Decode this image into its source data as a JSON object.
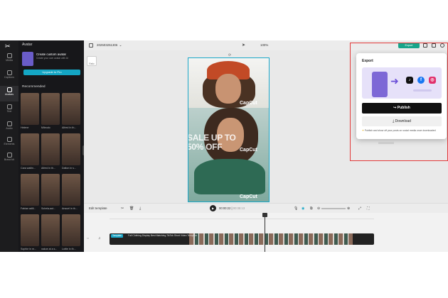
{
  "rail": {
    "items": [
      {
        "label": "Media"
      },
      {
        "label": "Captions"
      },
      {
        "label": "Avatars"
      },
      {
        "label": "Text"
      },
      {
        "label": "Audio"
      },
      {
        "label": "Elements"
      },
      {
        "label": "Brand kit"
      }
    ]
  },
  "panel": {
    "title": "Avatar",
    "promo": {
      "title": "Create custom avatar",
      "desc": "Create your own avatar with AI",
      "button": "Upgrade to Pro"
    },
    "section": "Recommended",
    "avatars": [
      {
        "label": "Helene"
      },
      {
        "label": "Mileodo"
      },
      {
        "label": "Alfred In th..."
      },
      {
        "label": "Cara waitin..."
      },
      {
        "label": "Alfred in th..."
      },
      {
        "label": "Dalton in s..."
      },
      {
        "label": "Fabian adili..."
      },
      {
        "label": "Schela-aut..."
      },
      {
        "label": "Ansuel in th..."
      },
      {
        "label": "Sophie in m..."
      },
      {
        "label": "xakoe at a s..."
      },
      {
        "label": "Lottie in th..."
      }
    ]
  },
  "topbar": {
    "project": "202503251306",
    "zoom": "100%",
    "export": "Export"
  },
  "canvas": {
    "ratio_label": "Ratio",
    "sale_line1": "SALE UP TO",
    "sale_line2": "50% OFF",
    "brand": "CapCut"
  },
  "timeline_bar": {
    "edit_template": "Edit template",
    "current": "00:00:22",
    "duration": "00:35:13"
  },
  "timeline": {
    "tag": "Template",
    "clip_name": "Fall Clothing Display Best Matching TikTok Short Video Template"
  },
  "export_modal": {
    "title": "Export",
    "socials": [
      {
        "name": "tiktok-icon",
        "glyph": "♪",
        "color": "#111111"
      },
      {
        "name": "facebook-icon",
        "glyph": "f",
        "color": "#1877f2"
      },
      {
        "name": "instagram-icon",
        "glyph": "◎",
        "color": "#e1306c"
      }
    ],
    "publish": "Publish",
    "download": "Download",
    "note": "Publish and show off your posts on social media once downloaded"
  },
  "colors": {
    "accent": "#1aa7c8",
    "export_green": "#17a58a",
    "highlight": "#e23a3a"
  }
}
